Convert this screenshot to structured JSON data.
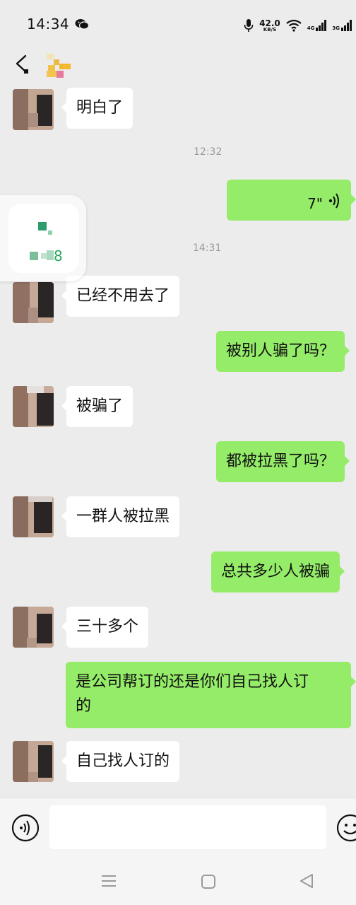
{
  "status": {
    "time": "14:34",
    "netspeed_value": "42.0",
    "netspeed_unit": "KB/S",
    "signal1": "4G",
    "signal2": "3G"
  },
  "messages": [
    {
      "side": "in",
      "text": "明白了"
    },
    {
      "timestamp": "12:32"
    },
    {
      "side": "out",
      "type": "voice",
      "duration": "7\""
    },
    {
      "timestamp": "14:31"
    },
    {
      "side": "in",
      "text": "已经不用去了"
    },
    {
      "side": "out",
      "text": "被别人骗了吗？"
    },
    {
      "side": "in",
      "text": "被骗了"
    },
    {
      "side": "out",
      "text": "都被拉黑了吗？"
    },
    {
      "side": "in",
      "text": "一群人被拉黑"
    },
    {
      "side": "out",
      "text": "总共多少人被骗"
    },
    {
      "side": "in",
      "text": "三十多个"
    },
    {
      "side": "out",
      "text": "是公司帮订的还是你们自己找人订\n的"
    },
    {
      "side": "in",
      "text": "自己找人订的"
    }
  ],
  "floating_widget": {
    "badge": "8"
  },
  "input": {
    "value": ""
  },
  "colors": {
    "outgoing_bubble": "#95ec69",
    "incoming_bubble": "#ffffff",
    "background": "#ececec"
  },
  "icons": [
    "wechat-icon",
    "mic-icon",
    "wifi-icon",
    "back-icon",
    "voice-wave-icon",
    "voice-toggle-icon",
    "emoji-icon",
    "nav-menu-icon",
    "nav-home-icon",
    "nav-back-icon"
  ]
}
